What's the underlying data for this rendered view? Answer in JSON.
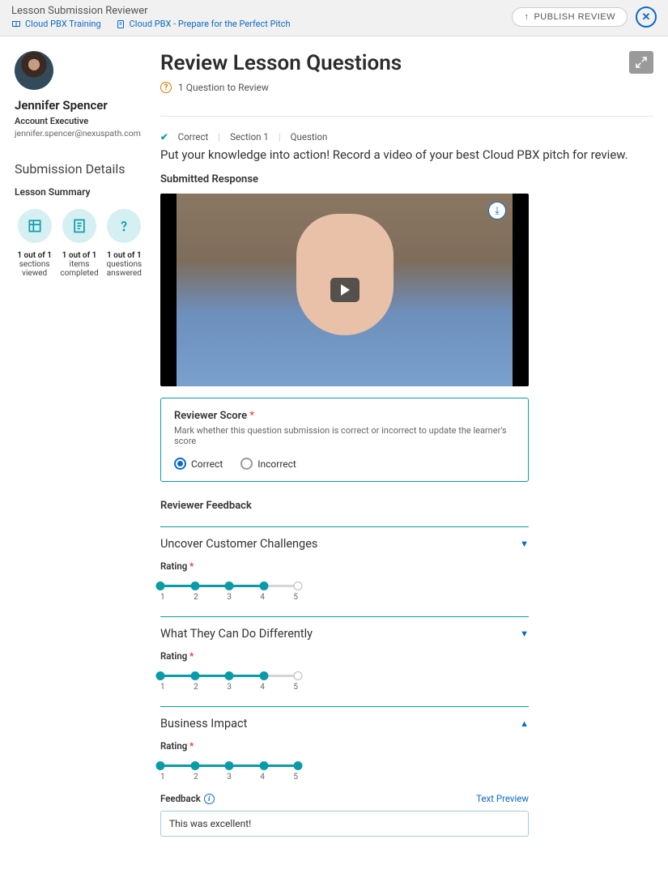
{
  "topbar": {
    "title": "Lesson Submission Reviewer",
    "crumb1": "Cloud PBX Training",
    "crumb2": "Cloud PBX - Prepare for the Perfect Pitch",
    "publish": "PUBLISH REVIEW"
  },
  "person": {
    "name": "Jennifer Spencer",
    "role": "Account Executive",
    "email": "jennifer.spencer@nexuspath.com"
  },
  "sidebar": {
    "details_h": "Submission Details",
    "summary_h": "Lesson Summary",
    "stats": [
      {
        "count": "1 out of 1",
        "l1": "sections",
        "l2": "viewed"
      },
      {
        "count": "1 out of 1",
        "l1": "items",
        "l2": "completed"
      },
      {
        "count": "1 out of 1",
        "l1": "questions",
        "l2": "answered"
      }
    ]
  },
  "main": {
    "title": "Review Lesson Questions",
    "review_count": "1 Question to Review",
    "tags": {
      "correct": "Correct",
      "section": "Section 1",
      "question": "Question"
    },
    "prompt": "Put your knowledge into action! Record a video of your best Cloud PBX pitch for review.",
    "submitted_h": "Submitted Response"
  },
  "score": {
    "title": "Reviewer Score",
    "desc": "Mark whether this question submission is correct or incorrect to update the learner's score",
    "opt1": "Correct",
    "opt2": "Incorrect"
  },
  "feedback_h": "Reviewer Feedback",
  "sections": [
    {
      "title": "Uncover Customer Challenges",
      "rating_label": "Rating",
      "value": 4,
      "max": 5,
      "expanded": false
    },
    {
      "title": "What They Can Do Differently",
      "rating_label": "Rating",
      "value": 4,
      "max": 5,
      "expanded": false
    },
    {
      "title": "Business Impact",
      "rating_label": "Rating",
      "value": 5,
      "max": 5,
      "expanded": true
    }
  ],
  "fb": {
    "label": "Feedback",
    "preview": "Text Preview",
    "value": "This was excellent!"
  },
  "ticks": [
    "1",
    "2",
    "3",
    "4",
    "5"
  ]
}
